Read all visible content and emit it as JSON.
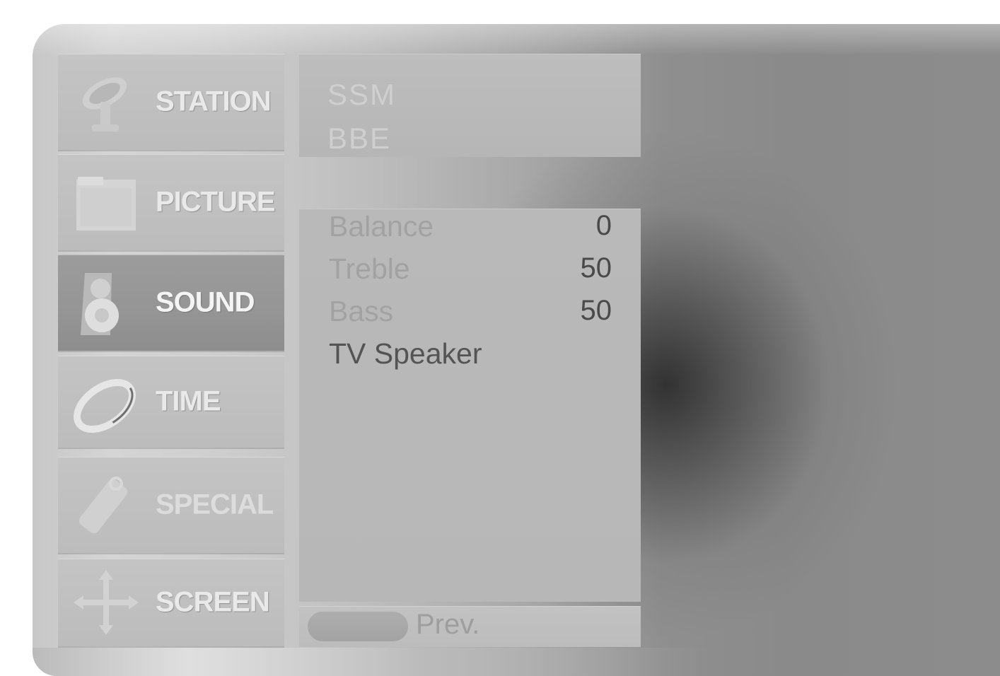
{
  "sidebar": {
    "items": [
      {
        "label": "STATION",
        "icon": "satellite-dish-icon",
        "active": false
      },
      {
        "label": "PICTURE",
        "icon": "picture-frame-icon",
        "active": false
      },
      {
        "label": "SOUND",
        "icon": "speaker-icon",
        "active": true
      },
      {
        "label": "TIME",
        "icon": "clock-ring-icon",
        "active": false
      },
      {
        "label": "SPECIAL",
        "icon": "tag-icon",
        "active": false
      },
      {
        "label": "SCREEN",
        "icon": "move-arrows-icon",
        "active": false
      }
    ]
  },
  "top_panel": {
    "items": [
      "SSM",
      "BBE"
    ]
  },
  "main_panel": {
    "rows": [
      {
        "label": "Balance",
        "value": "0"
      },
      {
        "label": "Treble",
        "value": "50"
      },
      {
        "label": "Bass",
        "value": "50"
      },
      {
        "label": "TV Speaker",
        "value": ""
      }
    ]
  },
  "footer": {
    "prev_label": "Prev."
  },
  "colors": {
    "frame_gradient_start": "#c7c7c7",
    "frame_gradient_end": "#8c8c8c",
    "panel_bg": "#b9b9b9",
    "active_tile": "#959595"
  }
}
